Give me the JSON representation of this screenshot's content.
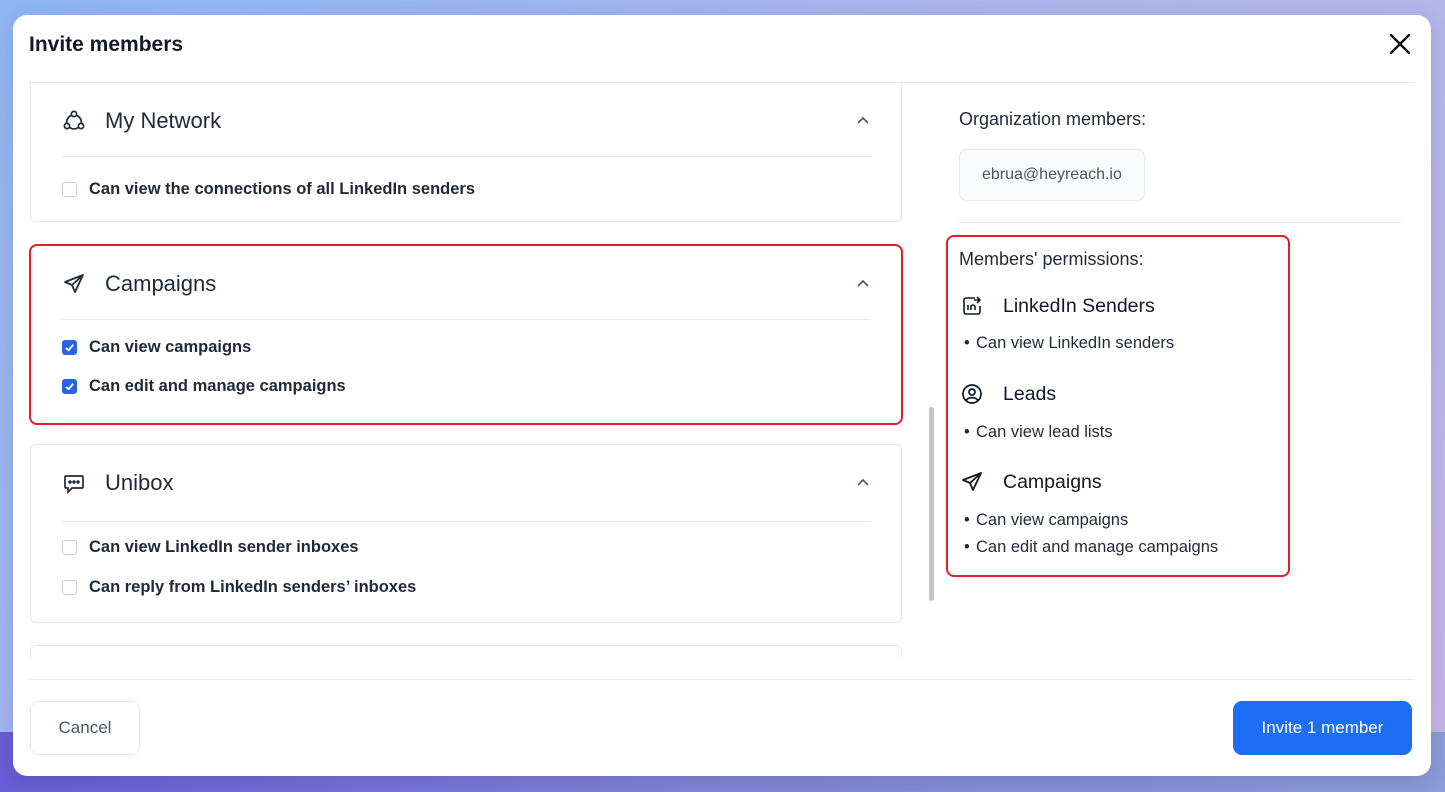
{
  "modal": {
    "title": "Invite members",
    "cancel_label": "Cancel",
    "invite_label": "Invite 1 member"
  },
  "sections": {
    "network": {
      "title": "My Network",
      "icon": "network-icon",
      "permissions": [
        {
          "label": "Can view the connections of all LinkedIn senders",
          "checked": false
        }
      ]
    },
    "campaigns": {
      "title": "Campaigns",
      "icon": "send-icon",
      "permissions": [
        {
          "label": "Can view campaigns",
          "checked": true
        },
        {
          "label": "Can edit and manage campaigns",
          "checked": true
        }
      ]
    },
    "unibox": {
      "title": "Unibox",
      "icon": "chat-icon",
      "permissions": [
        {
          "label": "Can view LinkedIn sender inboxes",
          "checked": false
        },
        {
          "label": "Can reply from LinkedIn senders’ inboxes",
          "checked": false
        }
      ]
    }
  },
  "right": {
    "org_label": "Organization members:",
    "email": "ebrua@heyreach.io",
    "perm_label": "Members' permissions:",
    "groups": [
      {
        "title": "LinkedIn Senders",
        "icon": "linkedin-icon",
        "items": [
          "Can view LinkedIn senders"
        ]
      },
      {
        "title": "Leads",
        "icon": "user-circle-icon",
        "items": [
          "Can view lead lists"
        ]
      },
      {
        "title": "Campaigns",
        "icon": "send-icon",
        "items": [
          "Can view campaigns",
          "Can edit and manage campaigns"
        ]
      }
    ]
  },
  "colors": {
    "primary": "#1d6ef5",
    "highlight": "#e11d2a",
    "checkbox": "#2563eb"
  }
}
